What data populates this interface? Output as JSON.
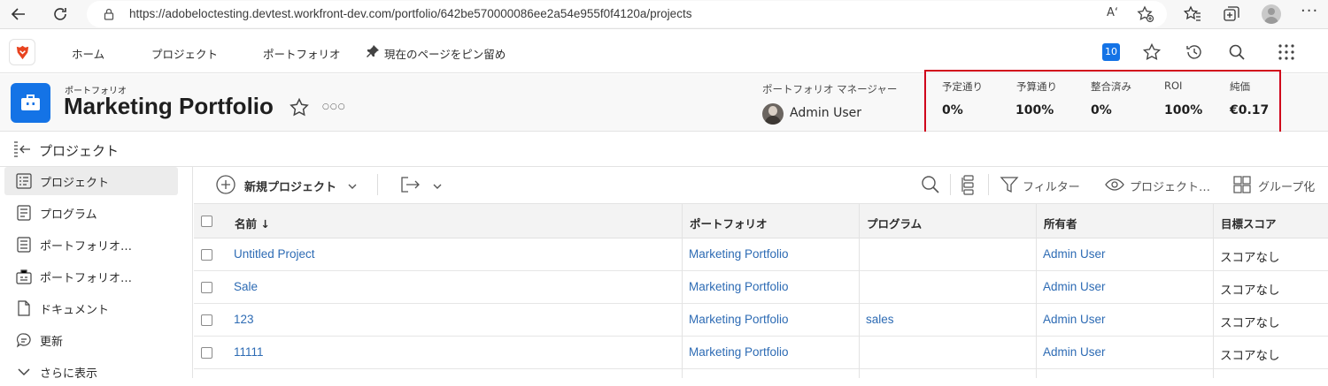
{
  "browser": {
    "url": "https://adobeloctesting.devtest.workfront-dev.com/portfolio/642be570000086ee2a54e955f0f4120a/projects",
    "read_aloud_label": "Aʻ"
  },
  "appnav": {
    "items": [
      {
        "label": "ホーム"
      },
      {
        "label": "プロジェクト"
      },
      {
        "label": "ポートフォリオ"
      },
      {
        "label": "現在のページをピン留め"
      }
    ],
    "notification_count": "10"
  },
  "header": {
    "object_type": "ポートフォリオ",
    "title": "Marketing Portfolio",
    "more_label": "○○○",
    "manager_label": "ポートフォリオ マネージャー",
    "manager_name": "Admin User",
    "metrics": [
      {
        "label": "予定通り",
        "value": "0%"
      },
      {
        "label": "予算通り",
        "value": "100%"
      },
      {
        "label": "整合済み",
        "value": "0%"
      },
      {
        "label": "ROI",
        "value": "100%"
      },
      {
        "label": "純価",
        "value": "€0.17"
      }
    ]
  },
  "subhead": {
    "title": "プロジェクト"
  },
  "sidebar": {
    "items": [
      {
        "label": "プロジェクト",
        "icon": "projects-icon",
        "active": true
      },
      {
        "label": "プログラム",
        "icon": "programs-icon"
      },
      {
        "label": "ポートフォリオ…",
        "icon": "portfolio-details-icon"
      },
      {
        "label": "ポートフォリオ…",
        "icon": "portfolio-optimizer-icon"
      },
      {
        "label": "ドキュメント",
        "icon": "document-icon"
      },
      {
        "label": "更新",
        "icon": "updates-icon"
      },
      {
        "label": "さらに表示",
        "icon": "chevron-down-icon"
      }
    ]
  },
  "toolbar": {
    "new_project": "新規プロジェクト",
    "filter": "フィルター",
    "view": "プロジェクト…",
    "group": "グループ化"
  },
  "table": {
    "columns": [
      "名前 ↓",
      "ポートフォリオ",
      "プログラム",
      "所有者",
      "目標スコア"
    ],
    "rows": [
      {
        "name": "Untitled Project",
        "portfolio": "Marketing Portfolio",
        "program": "",
        "owner": "Admin User",
        "score": "スコアなし"
      },
      {
        "name": "Sale",
        "portfolio": "Marketing Portfolio",
        "program": "",
        "owner": "Admin User",
        "score": "スコアなし"
      },
      {
        "name": "123",
        "portfolio": "Marketing Portfolio",
        "program": "sales",
        "owner": "Admin User",
        "score": "スコアなし"
      },
      {
        "name": "11111",
        "portfolio": "Marketing Portfolio",
        "program": "",
        "owner": "Admin User",
        "score": "スコアなし"
      }
    ]
  },
  "colors": {
    "accent": "#1473e6",
    "link": "#2d6bb4",
    "highlight_box": "#d0021b"
  }
}
